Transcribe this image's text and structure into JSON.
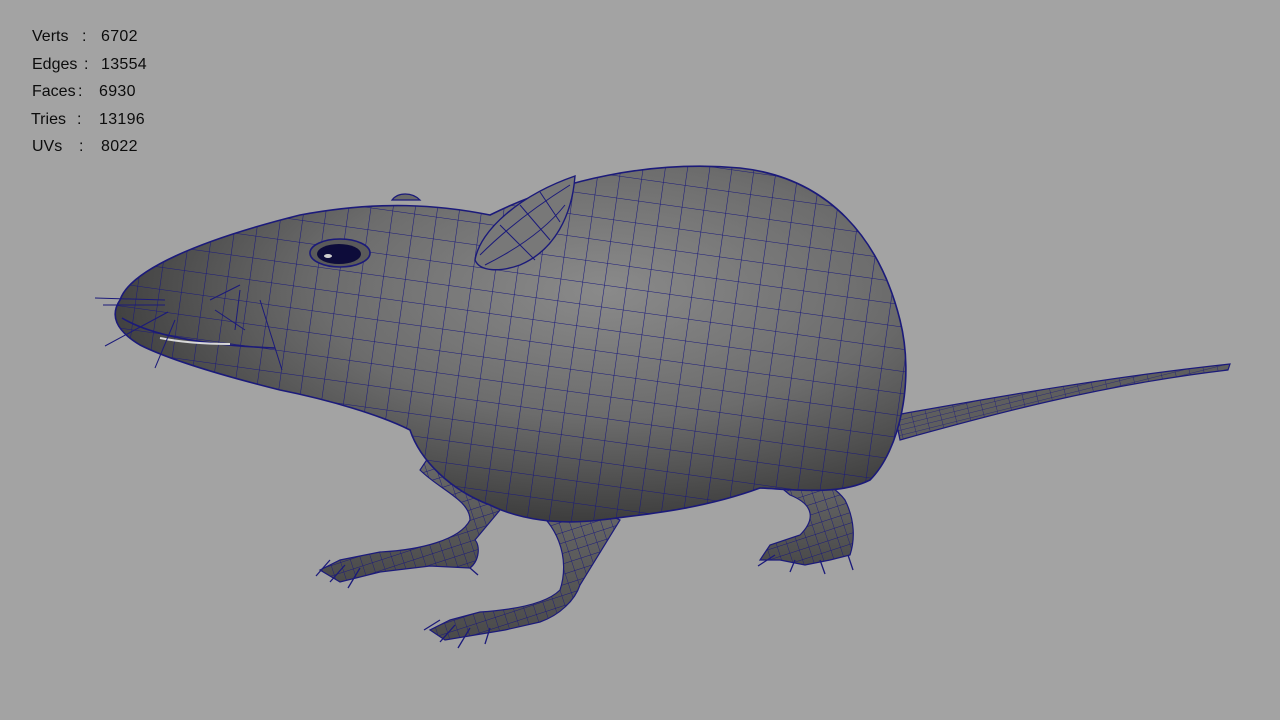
{
  "scene": {
    "background_color": "#a3a3a3",
    "model_name_icon": "rat-mesh-icon",
    "wire_color": "#1b1a7a",
    "surface_color": "#6f6f6f"
  },
  "stats": {
    "verts": {
      "label": "Verts",
      "colon": ":",
      "value": "6702"
    },
    "edges": {
      "label": "Edges",
      "colon": ":",
      "value": "13554"
    },
    "faces": {
      "label": "Faces",
      "colon": ":",
      "value": "6930"
    },
    "tris": {
      "label": "Tries",
      "colon": ":",
      "value": "13196"
    },
    "uvs": {
      "label": "UVs",
      "colon": ":",
      "value": "8022"
    }
  }
}
